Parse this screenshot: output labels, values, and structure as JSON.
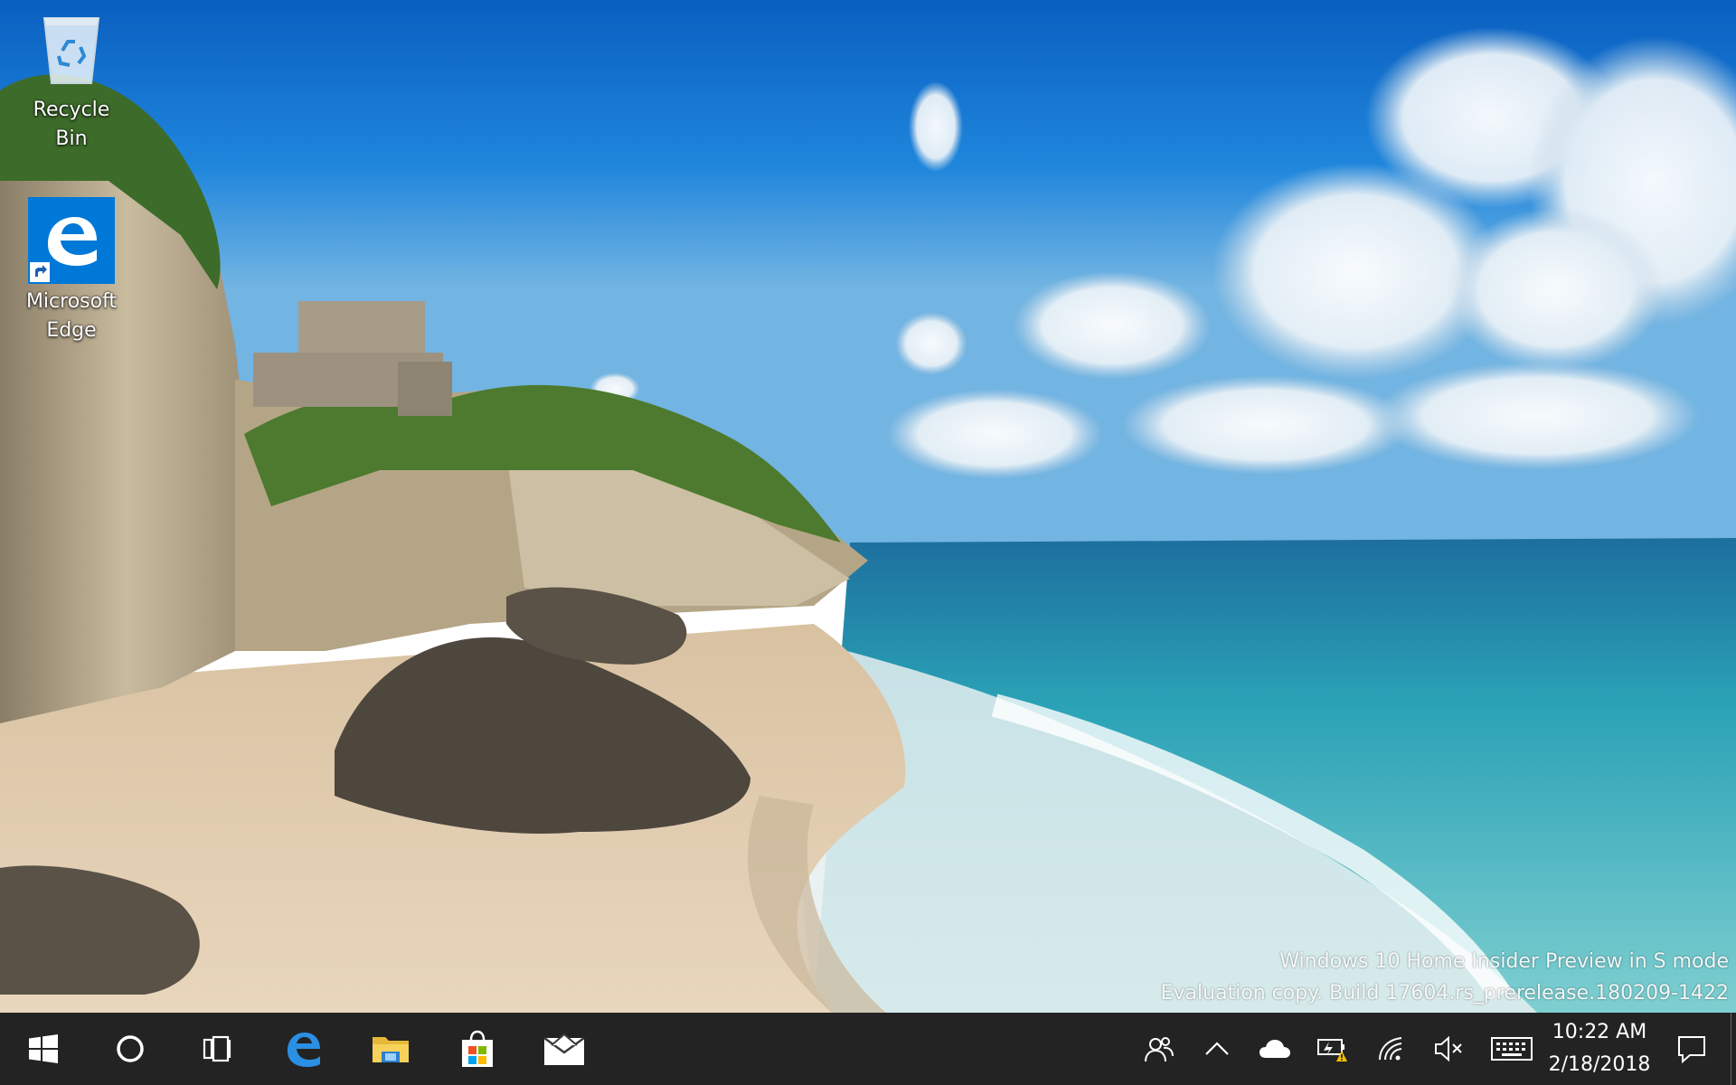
{
  "desktop": {
    "icons": [
      {
        "label": "Recycle Bin",
        "icon": "recycle-bin-icon"
      },
      {
        "label": "Microsoft Edge",
        "icon": "edge-icon",
        "shortcut": true
      }
    ],
    "watermark": {
      "line1": "Windows 10 Home Insider Preview in S mode",
      "line2": "Evaluation copy. Build 17604.rs_prerelease.180209-1422"
    }
  },
  "taskbar": {
    "pinned": [
      {
        "name": "start",
        "icon": "windows-logo-icon"
      },
      {
        "name": "cortana",
        "icon": "cortana-circle-icon"
      },
      {
        "name": "task-view",
        "icon": "task-view-icon"
      },
      {
        "name": "edge",
        "icon": "edge-icon"
      },
      {
        "name": "file-explorer",
        "icon": "folder-icon"
      },
      {
        "name": "store",
        "icon": "store-bag-icon"
      },
      {
        "name": "mail",
        "icon": "mail-envelope-icon"
      }
    ],
    "tray": {
      "icons": [
        "people-icon",
        "chevron-up-icon",
        "onedrive-cloud-icon",
        "battery-warning-icon",
        "wifi-icon",
        "volume-muted-icon",
        "touch-keyboard-icon",
        "action-center-icon"
      ],
      "time": "10:22 AM",
      "date": "2/18/2018"
    },
    "colors": {
      "background": "#121212",
      "edge_blue": "#0078d7"
    }
  }
}
